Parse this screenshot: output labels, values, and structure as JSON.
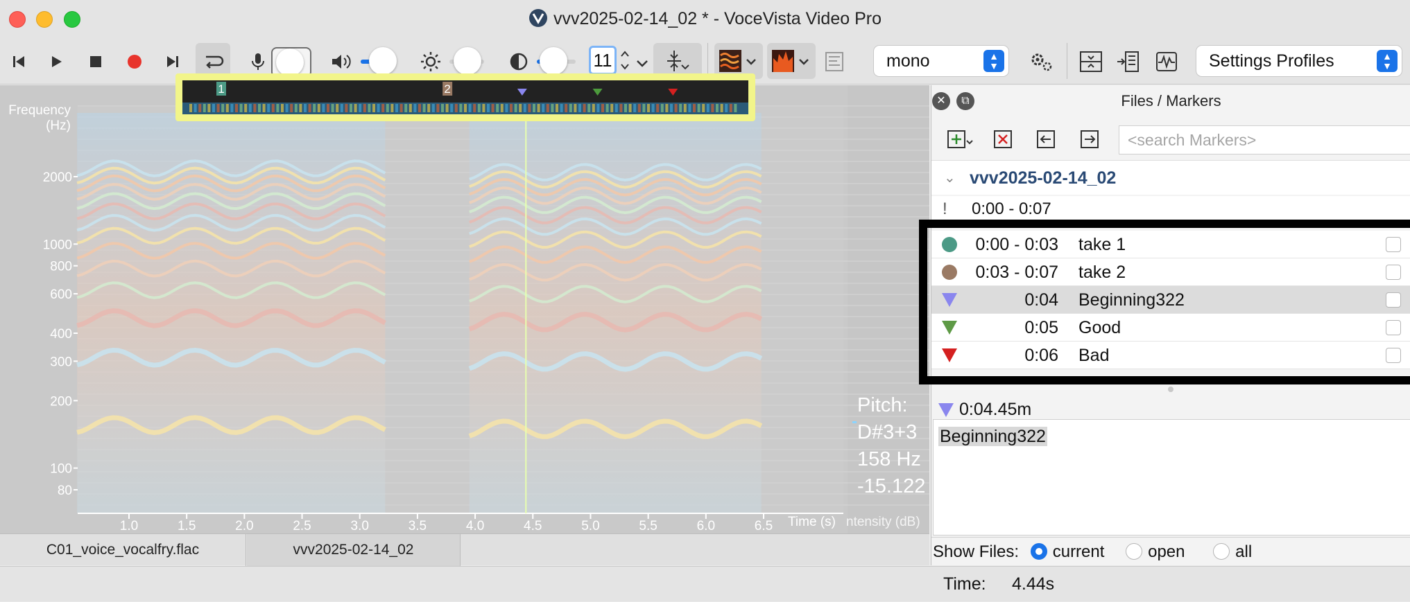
{
  "window": {
    "title": "vvv2025-02-14_02 *  - VoceVista Video Pro"
  },
  "toolbar": {
    "buttons": [
      "skip-start-icon",
      "play-icon",
      "stop-icon",
      "record-icon",
      "skip-end-icon",
      "loop-icon",
      "microphone-icon",
      "speaker-icon",
      "brightness-icon",
      "contrast-icon",
      "stepper-icon",
      "cursor-snap-icon",
      "spectrogram-color-icon",
      "spectrum-color-icon",
      "layout-icon",
      "gear-icon",
      "split-view-icon",
      "insert-icon",
      "waveform-icon"
    ],
    "number_value": "11",
    "channel_select": "mono",
    "profiles_select": "Settings Profiles",
    "colors": {
      "accent": "#1a73e8"
    }
  },
  "spectrogram": {
    "y_axis_title": "Frequency\n(Hz)",
    "y_ticks": [
      {
        "label": "2000",
        "value": 2000
      },
      {
        "label": "1000",
        "value": 1000
      },
      {
        "label": "800",
        "value": 800
      },
      {
        "label": "600",
        "value": 600
      },
      {
        "label": "400",
        "value": 400
      },
      {
        "label": "300",
        "value": 300
      },
      {
        "label": "200",
        "value": 200
      },
      {
        "label": "100",
        "value": 100
      },
      {
        "label": "80",
        "value": 80
      }
    ],
    "x_ticks": [
      "1.0",
      "1.5",
      "2.0",
      "2.5",
      "3.0",
      "3.5",
      "4.0",
      "4.5",
      "5.0",
      "5.5",
      "6.0",
      "6.5"
    ],
    "x_axis_title": "Time (s)",
    "intensity_label": "ntensity (dB)",
    "cursor_time": 4.44,
    "overview_markers": [
      {
        "label": "1",
        "color": "#4c9a86",
        "time": 0.0
      },
      {
        "label": "2",
        "color": "#9a7a64",
        "time": 3.0
      }
    ],
    "overview_flags": [
      {
        "color": "#8a86ee",
        "time": 4.0
      },
      {
        "color": "#4c9a3c",
        "time": 5.0
      },
      {
        "color": "#d42020",
        "time": 6.0
      }
    ]
  },
  "pitch": {
    "label": "Pitch:",
    "note": "D#3+3",
    "hz": "158 Hz",
    "db": "-15.122"
  },
  "bottom_tabs": [
    {
      "label": "C01_voice_vocalfry.flac",
      "active": false
    },
    {
      "label": "vvv2025-02-14_02",
      "active": true
    }
  ],
  "panel": {
    "title": "Files / Markers",
    "search_placeholder": "<search Markers>",
    "group": "vvv2025-02-14_02",
    "partial_row": "0:00 - 0:07",
    "markers": [
      {
        "type": "circle",
        "color": "#4c9a86",
        "time": "0:00 - 0:03",
        "label": "take 1",
        "selected": false
      },
      {
        "type": "circle",
        "color": "#9a7a64",
        "time": "0:03 - 0:07",
        "label": "take 2",
        "selected": false
      },
      {
        "type": "triangle",
        "color": "#8a86ee",
        "time": "0:04",
        "label": "Beginning322",
        "selected": true
      },
      {
        "type": "triangle",
        "color": "#5e9a46",
        "time": "0:05",
        "label": "Good",
        "selected": false
      },
      {
        "type": "triangle",
        "color": "#d42020",
        "time": "0:06",
        "label": "Bad",
        "selected": false
      }
    ],
    "position": "0:04.45m",
    "note_text": "Beginning322",
    "show_files_label": "Show Files:",
    "show_files_options": [
      {
        "label": "current",
        "checked": true
      },
      {
        "label": "open",
        "checked": false
      },
      {
        "label": "all",
        "checked": false
      }
    ]
  },
  "status": {
    "time_label": "Time:",
    "time_value": "4.44s"
  }
}
